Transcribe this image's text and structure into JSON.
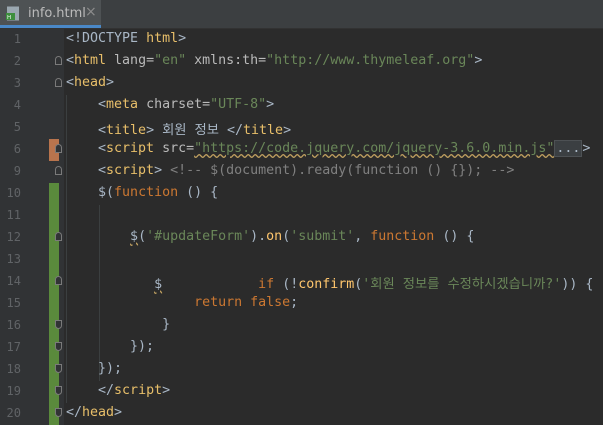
{
  "tab": {
    "label": "info.html",
    "close": "×",
    "icon": "html-file-icon"
  },
  "lines": [
    {
      "n": "1",
      "segs": [
        [
          "p",
          "<!DOCTYPE "
        ],
        [
          "t",
          "html"
        ],
        [
          "p",
          ">"
        ]
      ]
    },
    {
      "n": "2",
      "segs": [
        [
          "p",
          "<"
        ],
        [
          "t",
          "html "
        ],
        [
          "a",
          "lang="
        ],
        [
          "s",
          "\"en\" "
        ],
        [
          "a",
          "xmlns:th="
        ],
        [
          "s",
          "\"http://www.thymeleaf.org\""
        ],
        [
          "p",
          ">"
        ]
      ]
    },
    {
      "n": "3",
      "segs": [
        [
          "p",
          "<"
        ],
        [
          "t",
          "head"
        ],
        [
          "p",
          ">"
        ]
      ]
    },
    {
      "n": "4",
      "segs": [
        [
          "p",
          "    <"
        ],
        [
          "t",
          "meta "
        ],
        [
          "a",
          "charset="
        ],
        [
          "s",
          "\"UTF-8\""
        ],
        [
          "p",
          ">"
        ]
      ]
    },
    {
      "n": "5",
      "segs": [
        [
          "p",
          "    <"
        ],
        [
          "t",
          "title"
        ],
        [
          "p",
          "> 회원 정보 </"
        ],
        [
          "t",
          "title"
        ],
        [
          "p",
          ">"
        ]
      ]
    },
    {
      "n": "6",
      "segs": [
        [
          "p",
          "    <"
        ],
        [
          "t",
          "script "
        ],
        [
          "a",
          "src="
        ],
        [
          "s",
          "\"https://code.jquery.com/jquery-3.6.0.min.js\""
        ],
        [
          "fold-hint",
          "..."
        ],
        [
          "p",
          ">"
        ]
      ]
    },
    {
      "n": "9",
      "segs": [
        [
          "p",
          "    <"
        ],
        [
          "t",
          "script"
        ],
        [
          "p",
          "> "
        ],
        [
          "c",
          "<!-- $(document).ready(function () {}); -->"
        ]
      ]
    },
    {
      "n": "10",
      "segs": [
        [
          "p",
          "    $("
        ],
        [
          "k",
          "function "
        ],
        [
          "p",
          "() {"
        ]
      ]
    },
    {
      "n": "11",
      "segs": []
    },
    {
      "n": "12",
      "segs": [
        [
          "p",
          "        $("
        ],
        [
          "s",
          "'#updateForm'"
        ],
        [
          "p",
          ")."
        ],
        [
          "f",
          "on"
        ],
        [
          "p",
          "("
        ],
        [
          "s",
          "'submit'"
        ],
        [
          "p",
          ", "
        ],
        [
          "k",
          "function "
        ],
        [
          "p",
          "() {"
        ]
      ]
    },
    {
      "n": "13",
      "segs": []
    },
    {
      "n": "14",
      "segs": [
        [
          "p",
          "            "
        ],
        [
          "k",
          "if "
        ],
        [
          "p",
          "(!"
        ],
        [
          "f",
          "confirm"
        ],
        [
          "p",
          "("
        ],
        [
          "s",
          "'회원 정보를 수정하시겠습니까?'"
        ],
        [
          "p",
          ")) {"
        ]
      ]
    },
    {
      "n": "15",
      "segs": [
        [
          "p",
          "                "
        ],
        [
          "k",
          "return false"
        ],
        [
          "p",
          ";"
        ]
      ]
    },
    {
      "n": "16",
      "segs": [
        [
          "p",
          "            }"
        ]
      ]
    },
    {
      "n": "17",
      "segs": [
        [
          "p",
          "        });"
        ]
      ]
    },
    {
      "n": "18",
      "segs": [
        [
          "p",
          "    });"
        ]
      ]
    },
    {
      "n": "19",
      "segs": [
        [
          "p",
          "    </"
        ],
        [
          "t",
          "script"
        ],
        [
          "p",
          ">"
        ]
      ]
    },
    {
      "n": "20",
      "segs": [
        [
          "p",
          "</"
        ],
        [
          "t",
          "head"
        ],
        [
          "p",
          ">"
        ]
      ]
    }
  ]
}
